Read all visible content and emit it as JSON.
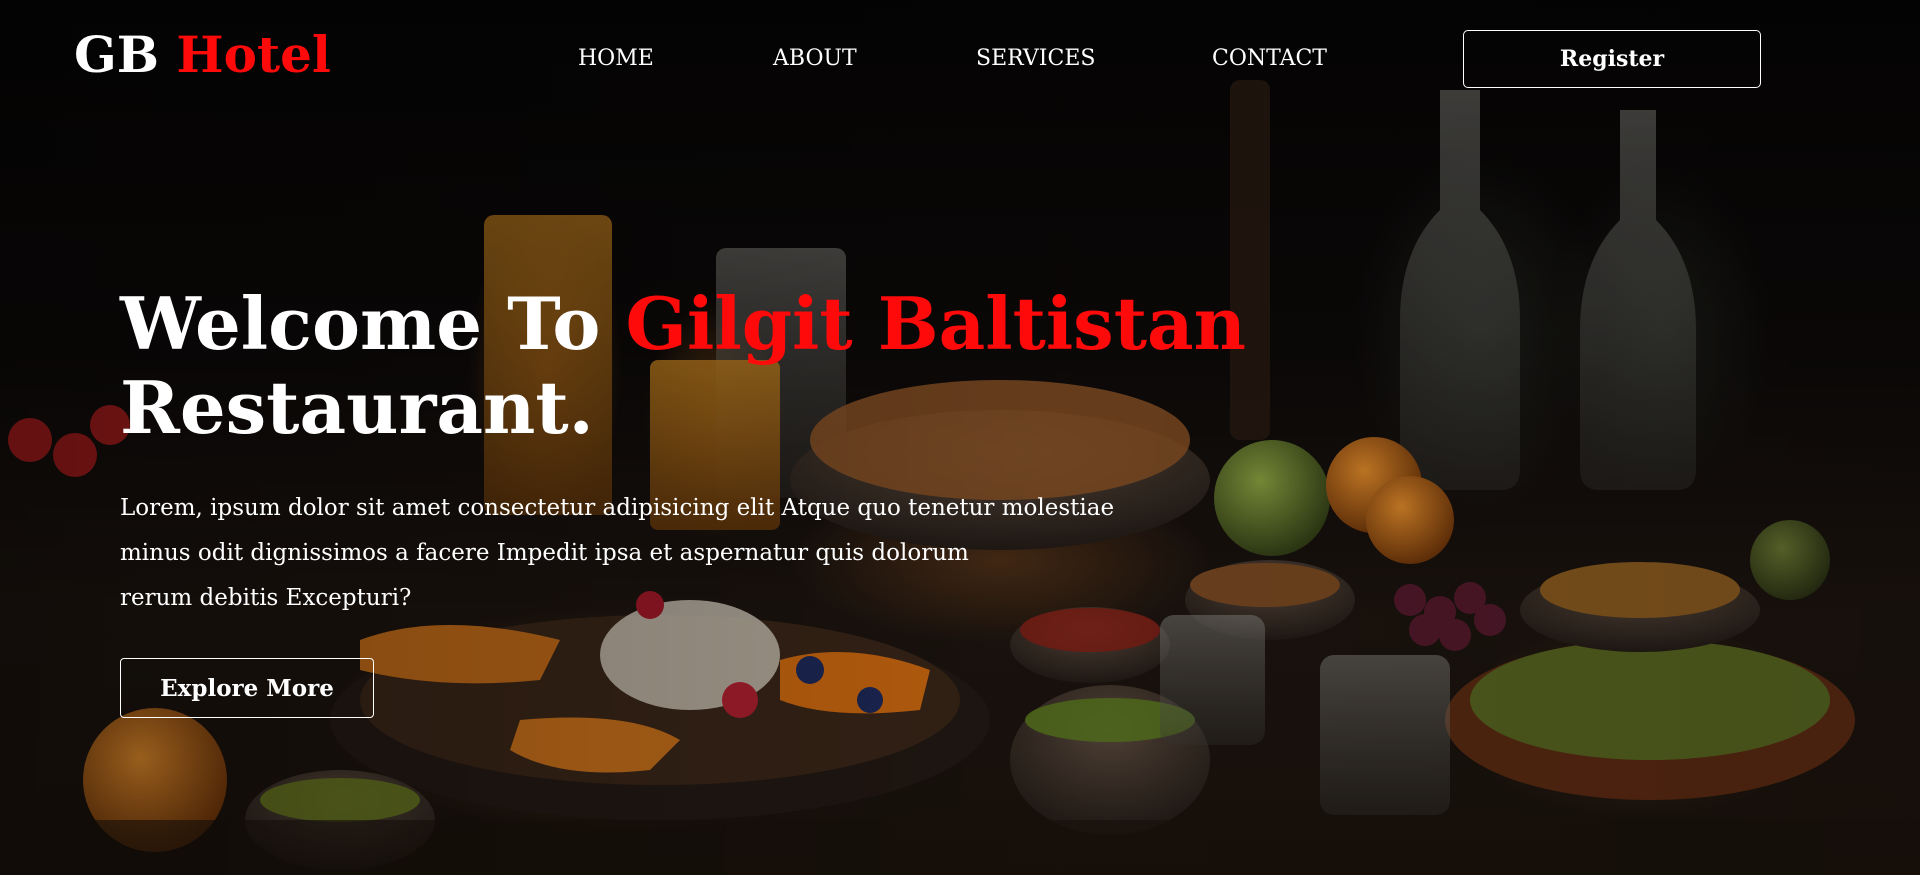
{
  "brand": {
    "name_part1": "GB",
    "name_part2": "Hotel",
    "accent_color": "#ff0a0a"
  },
  "nav": {
    "items": [
      {
        "label": "HOME"
      },
      {
        "label": "ABOUT"
      },
      {
        "label": "SERVICES"
      },
      {
        "label": "CONTACT"
      }
    ],
    "register_label": "Register"
  },
  "hero": {
    "title_part1": "Welcome To",
    "title_accent": "Gilgit Baltistan",
    "title_line2": "Restaurant.",
    "description_lines": [
      "Lorem, ipsum dolor sit amet consectetur adipisicing elit Atque quo tenetur molestiae",
      "minus odit dignissimos a facere Impedit ipsa et aspernatur quis dolorum",
      "rerum debitis Excepturi?"
    ],
    "cta_label": "Explore More",
    "background_image": "dark-food-table-photo"
  }
}
